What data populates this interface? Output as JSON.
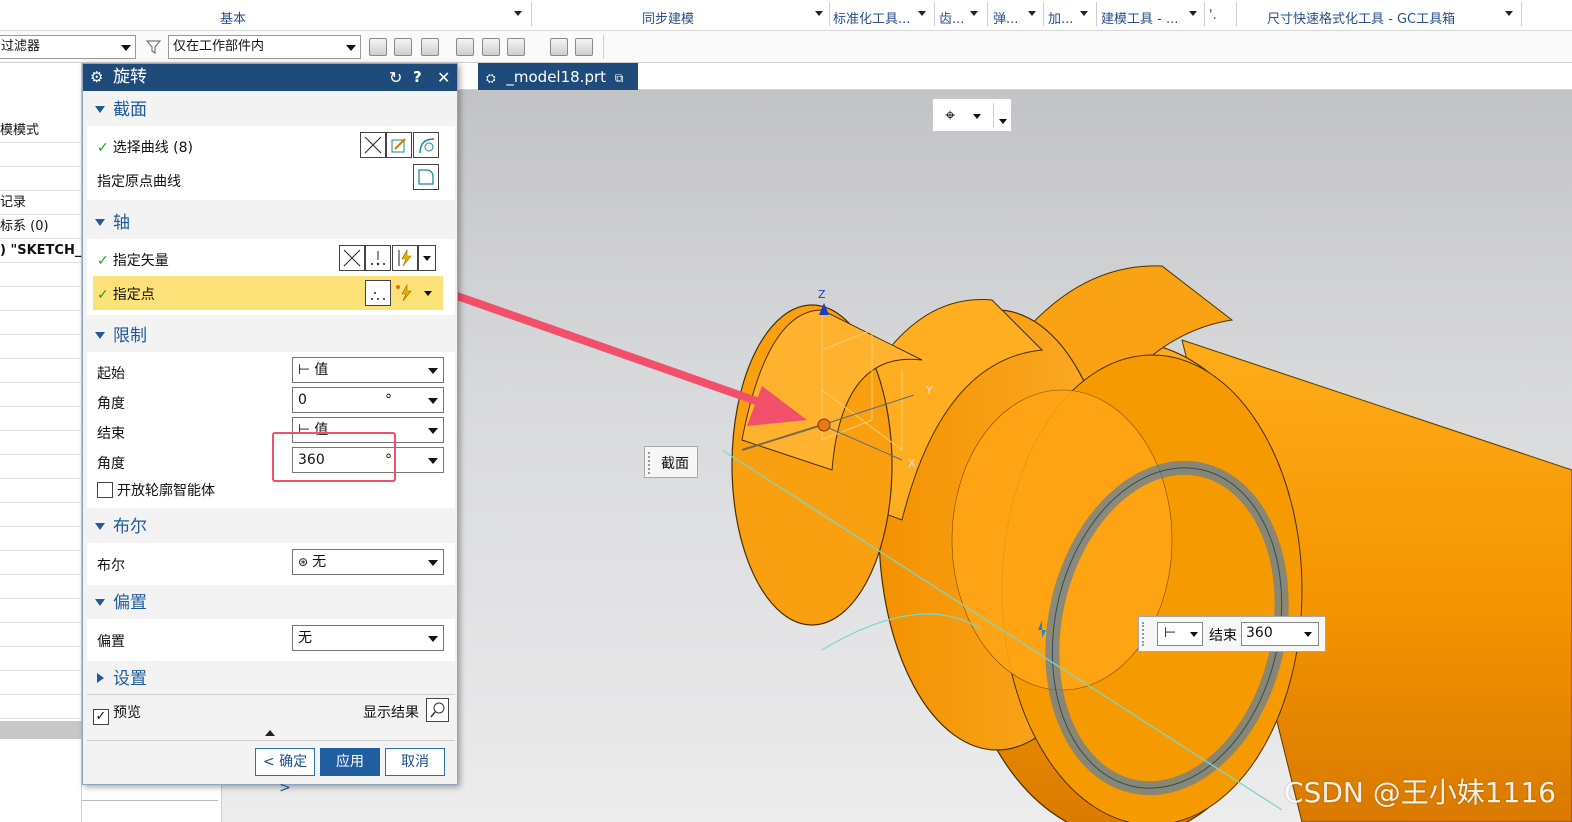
{
  "ribbon": {
    "groups": [
      "基本",
      "同步建模",
      "标准化工具...",
      "齿...",
      "弹...",
      "加...",
      "建模工具 - ...",
      "'.",
      "尺寸快速格式化工具 - GC工具箱"
    ]
  },
  "selection_bar": {
    "filter_value": "过滤器",
    "scope_value": "仅在工作部件内"
  },
  "navigator": {
    "rows": [
      "模模式",
      "记录",
      "标系 (0)",
      ") \"SKETCH_"
    ]
  },
  "tab": {
    "label": "_model18.prt"
  },
  "dialog": {
    "title": "旋转",
    "section": {
      "header": "截面",
      "select_curve": "选择曲线 (8)",
      "origin_curve": "指定原点曲线"
    },
    "axis": {
      "header": "轴",
      "vector": "指定矢量",
      "point": "指定点"
    },
    "limits": {
      "header": "限制",
      "start_label": "起始",
      "start_value": "值",
      "start_angle_label": "角度",
      "start_angle_value": "0",
      "end_label": "结束",
      "end_value": "值",
      "end_angle_label": "角度",
      "end_angle_value": "360",
      "unit": "°",
      "open_profile": "开放轮廓智能体"
    },
    "boolean": {
      "header": "布尔",
      "label": "布尔",
      "value": "无"
    },
    "offset": {
      "header": "偏置",
      "label": "偏置",
      "value": "无"
    },
    "settings": {
      "header": "设置"
    },
    "preview": "预览",
    "show_result": "显示结果",
    "buttons": {
      "ok": "< 确定 >",
      "apply": "应用",
      "cancel": "取消"
    }
  },
  "viewport": {
    "section_label": "截面",
    "end_label": "结束",
    "end_value": "360",
    "axis_z": "Z",
    "axis_y": "Y",
    "axis_x": "X"
  },
  "watermark": "CSDN @王小妹1116",
  "colors": {
    "part": "#f59a00",
    "accent": "#1f4b7a",
    "highlight": "#fde27a",
    "annotation": "#f2506a"
  }
}
